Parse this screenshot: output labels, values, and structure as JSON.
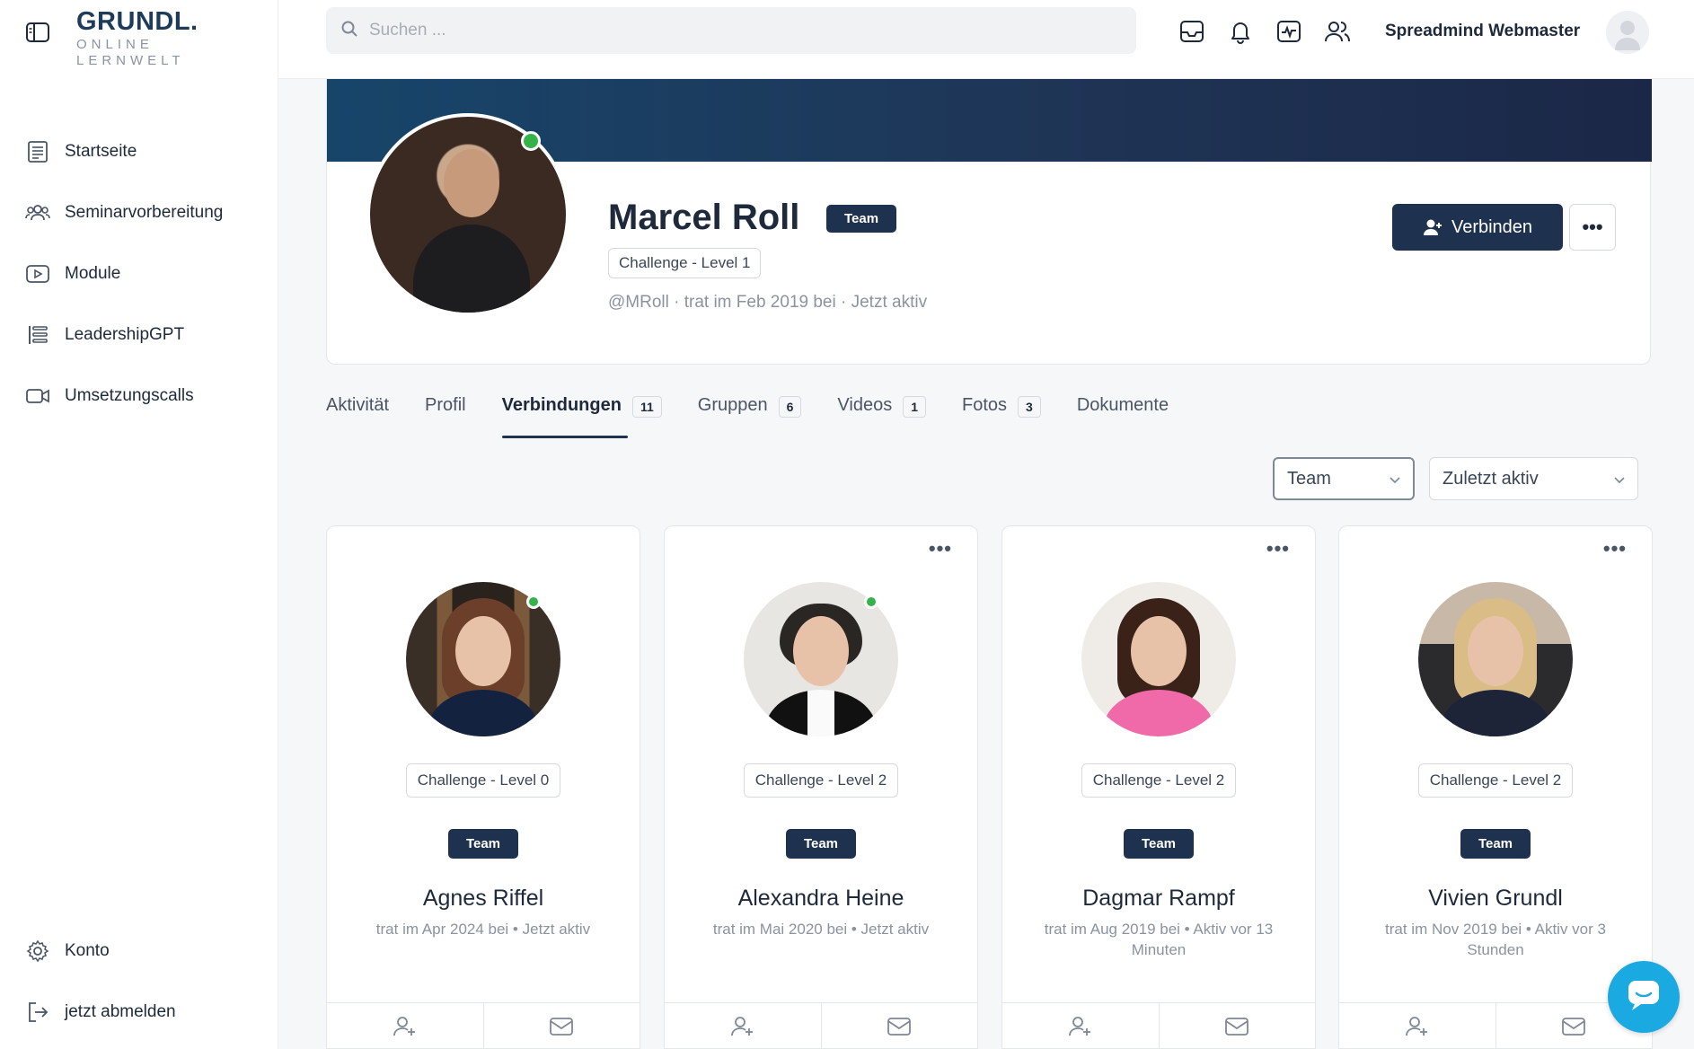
{
  "brand": {
    "name": "GRUNDL.",
    "line1": "ONLINE",
    "line2": "LERNWELT"
  },
  "sidebar": {
    "items": [
      {
        "label": "Startseite",
        "icon": "newspaper-icon"
      },
      {
        "label": "Seminarvorbereitung",
        "icon": "users-icon"
      },
      {
        "label": "Module",
        "icon": "video-play-icon"
      },
      {
        "label": "LeadershipGPT",
        "icon": "list-icon"
      },
      {
        "label": "Umsetzungscalls",
        "icon": "video-camera-icon"
      }
    ],
    "bottom": [
      {
        "label": "Konto",
        "icon": "gear-icon"
      },
      {
        "label": "jetzt abmelden",
        "icon": "logout-icon"
      }
    ]
  },
  "topbar": {
    "search_placeholder": "Suchen ...",
    "user_name": "Spreadmind Webmaster"
  },
  "profile": {
    "name": "Marcel Roll",
    "badge": "Team",
    "level": "Challenge - Level 1",
    "meta": "@MRoll · trat im Feb 2019 bei · Jetzt aktiv",
    "connect_label": "Verbinden",
    "more_label": "•••"
  },
  "tabs": [
    {
      "label": "Aktivität",
      "count": ""
    },
    {
      "label": "Profil",
      "count": ""
    },
    {
      "label": "Verbindungen",
      "count": "11"
    },
    {
      "label": "Gruppen",
      "count": "6"
    },
    {
      "label": "Videos",
      "count": "1"
    },
    {
      "label": "Fotos",
      "count": "3"
    },
    {
      "label": "Dokumente",
      "count": ""
    }
  ],
  "filters": {
    "type": "Team",
    "order": "Zuletzt aktiv"
  },
  "members": [
    {
      "name": "Agnes Riffel",
      "level": "Challenge - Level 0",
      "badge": "Team",
      "meta": "trat im Apr 2024 bei • Jetzt aktiv"
    },
    {
      "name": "Alexandra Heine",
      "level": "Challenge - Level 2",
      "badge": "Team",
      "meta": "trat im Mai 2020 bei • Jetzt aktiv"
    },
    {
      "name": "Dagmar Rampf",
      "level": "Challenge - Level 2",
      "badge": "Team",
      "meta": "trat im Aug 2019 bei • Aktiv vor 13 Minuten"
    },
    {
      "name": "Vivien Grundl",
      "level": "Challenge - Level 2",
      "badge": "Team",
      "meta": "trat im Nov 2019 bei • Aktiv vor 3 Stunden"
    }
  ],
  "card_more": "•••",
  "colors": {
    "primary": "#1e3250",
    "online": "#34b34a",
    "chat": "#1aa9e0"
  }
}
